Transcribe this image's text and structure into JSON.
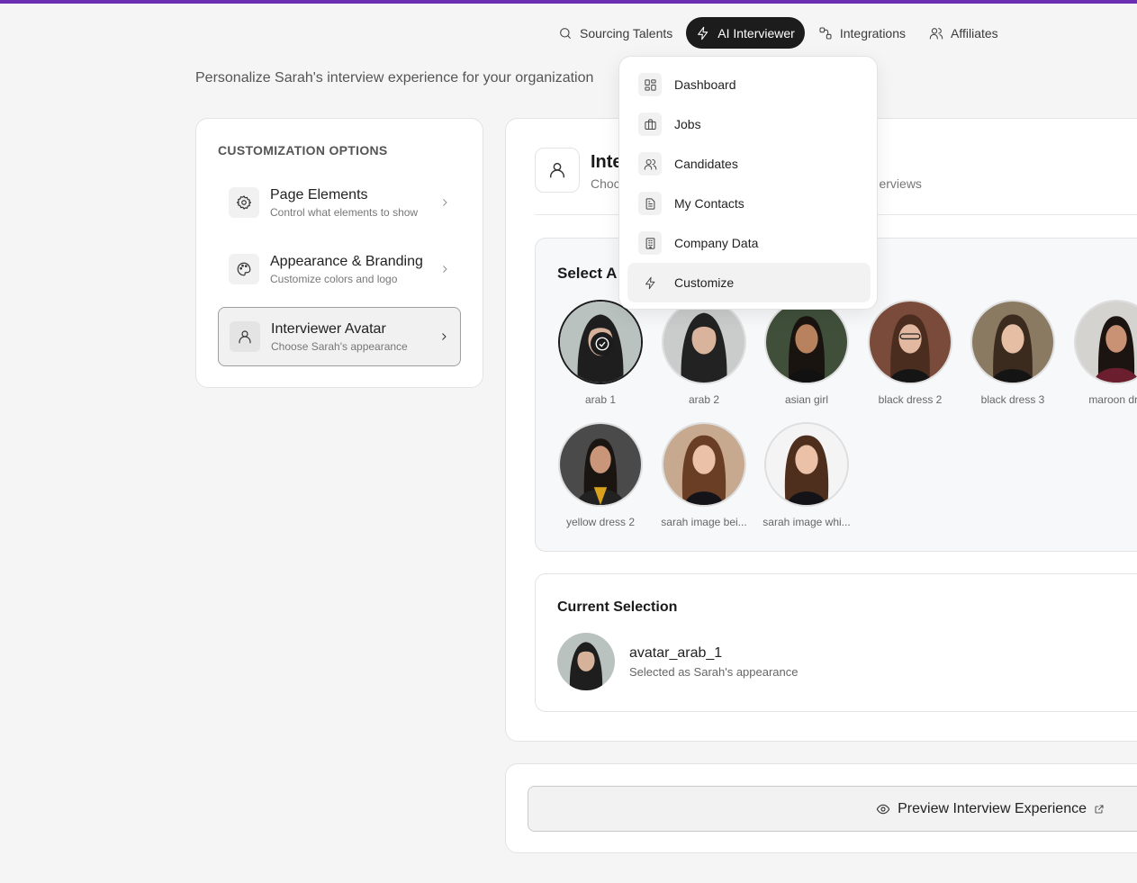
{
  "brand": {
    "accent": "#6b2fb3",
    "dark": "#1c1c1c"
  },
  "nav": [
    {
      "label": "Sourcing Talents",
      "icon": "search-icon",
      "active": false
    },
    {
      "label": "AI Interviewer",
      "icon": "lightning-icon",
      "active": true
    },
    {
      "label": "Integrations",
      "icon": "integrations-icon",
      "active": false
    },
    {
      "label": "Affiliates",
      "icon": "users-icon",
      "active": false
    }
  ],
  "page": {
    "subtitle": "Personalize Sarah's interview experience for your organization"
  },
  "sidebar": {
    "heading": "CUSTOMIZATION OPTIONS",
    "items": [
      {
        "title": "Page Elements",
        "desc": "Control what elements to show",
        "icon": "gear-icon"
      },
      {
        "title": "Appearance & Branding",
        "desc": "Customize colors and logo",
        "icon": "palette-icon"
      },
      {
        "title": "Interviewer Avatar",
        "desc": "Choose Sarah's appearance",
        "icon": "user-icon"
      }
    ]
  },
  "main": {
    "header_title": "Inte",
    "header_desc_left": "Choc",
    "header_desc_right": "erviews",
    "select_title": "Select A",
    "avatars": [
      {
        "label": "arab 1",
        "selected": true
      },
      {
        "label": "arab 2",
        "selected": false
      },
      {
        "label": "asian girl",
        "selected": false
      },
      {
        "label": "black dress 2",
        "selected": false
      },
      {
        "label": "black dress 3",
        "selected": false
      },
      {
        "label": "maroon dre",
        "selected": false
      },
      {
        "label": "yellow dress 2",
        "selected": false
      },
      {
        "label": "sarah image bei...",
        "selected": false
      },
      {
        "label": "sarah image whi...",
        "selected": false
      }
    ],
    "current": {
      "title": "Current Selection",
      "name": "avatar_arab_1",
      "desc": "Selected as Sarah's appearance"
    },
    "preview_label": "Preview Interview Experience"
  },
  "dropdown": {
    "items": [
      {
        "label": "Dashboard",
        "icon": "dashboard-icon"
      },
      {
        "label": "Jobs",
        "icon": "briefcase-icon"
      },
      {
        "label": "Candidates",
        "icon": "users-icon"
      },
      {
        "label": "My Contacts",
        "icon": "contacts-icon"
      },
      {
        "label": "Company Data",
        "icon": "building-icon"
      },
      {
        "label": "Customize",
        "icon": "lightning-icon"
      }
    ]
  }
}
